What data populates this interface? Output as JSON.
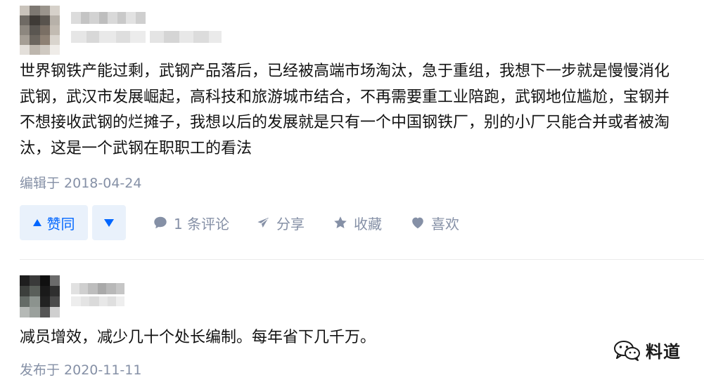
{
  "answer": {
    "lines": [
      "世界钢铁产能过剩，武钢产品落后，已经被高端市场淘汰，急于重组，我想下一步就是慢慢消化",
      "武钢，武汉市发展崛起，高科技和旅游城市结合，不再需要重工业陪跑，武钢地位尴尬，宝钢并",
      "不想接收武钢的烂摊子，我想以后的发展就是只有一个中国钢铁厂，别的小厂只能合并或者被淘",
      "汰，这是一个武钢在职职工的看法"
    ],
    "edited_label": "编辑于 2018-04-24"
  },
  "actions": {
    "upvote_label": "赞同",
    "comments_label": "1 条评论",
    "share_label": "分享",
    "collect_label": "收藏",
    "like_label": "喜欢"
  },
  "comment": {
    "text": "减员增效，减少几十个处长编制。每年省下几千万。",
    "published_label": "发布于 2020-11-11"
  },
  "watermark": {
    "text": "料道"
  },
  "colors": {
    "text": "#121212",
    "meta": "#8590a6",
    "brand_blue": "#0066ff",
    "vote_bg": "#e9f1fb"
  }
}
